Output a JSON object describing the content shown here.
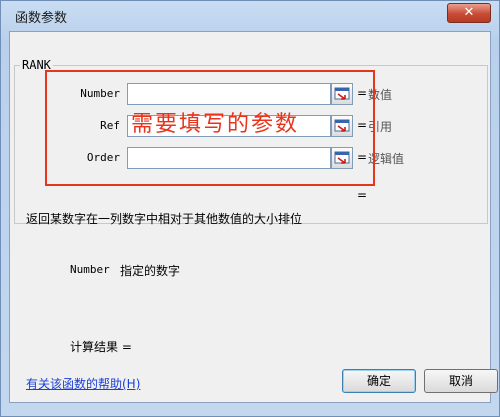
{
  "dialog": {
    "title": "函数参数",
    "close_label": "✕"
  },
  "function": {
    "name": "RANK",
    "args": [
      {
        "label": "Number",
        "value": "",
        "hint": "数值"
      },
      {
        "label": "Ref",
        "value": "",
        "hint": "引用"
      },
      {
        "label": "Order",
        "value": "",
        "hint": "逻辑值"
      }
    ],
    "equals": "="
  },
  "annotation": {
    "text": "需要填写的参数",
    "color": "#e8341c"
  },
  "description": "返回某数字在一列数字中相对于其他数值的大小排位",
  "param_help": {
    "name": "Number",
    "text": "指定的数字"
  },
  "calc_result_label": "计算结果 =",
  "help_link": "有关该函数的帮助(H)",
  "buttons": {
    "ok": "确定",
    "cancel": "取消"
  }
}
